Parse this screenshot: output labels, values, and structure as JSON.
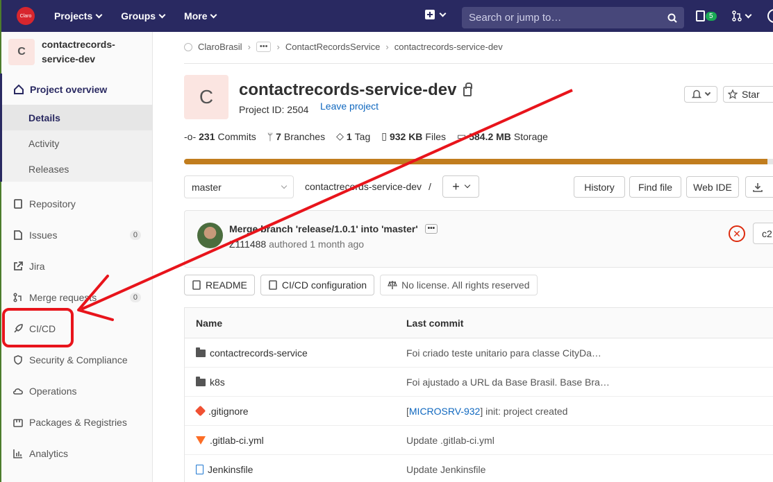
{
  "navbar": {
    "logo_text": "Claro",
    "projects_label": "Projects",
    "groups_label": "Groups",
    "more_label": "More",
    "search_placeholder": "Search or jump to…",
    "issues_count": "5"
  },
  "sidebar": {
    "project_initial": "C",
    "project_name": "contactrecords-service-dev",
    "overview_label": "Project overview",
    "subitems": [
      {
        "label": "Details"
      },
      {
        "label": "Activity"
      },
      {
        "label": "Releases"
      }
    ],
    "items": [
      {
        "label": "Repository"
      },
      {
        "label": "Issues",
        "count": "0"
      },
      {
        "label": "Jira"
      },
      {
        "label": "Merge requests",
        "count": "0"
      },
      {
        "label": "CI/CD"
      },
      {
        "label": "Security & Compliance"
      },
      {
        "label": "Operations"
      },
      {
        "label": "Packages & Registries"
      },
      {
        "label": "Analytics"
      }
    ]
  },
  "breadcrumb": {
    "root": "ClaroBrasil",
    "ellipsis": "•••",
    "group": "ContactRecordsService",
    "project": "contactrecords-service-dev"
  },
  "project": {
    "initial": "C",
    "name": "contactrecords-service-dev",
    "id_text": "Project ID: 2504",
    "leave_label": "Leave project",
    "star_label": "Star"
  },
  "stats": {
    "commits": "231",
    "commits_label": "Commits",
    "branches": "7",
    "branches_label": "Branches",
    "tags": "1",
    "tags_label": "Tag",
    "files": "932 KB",
    "files_label": "Files",
    "storage": "584.2 MB",
    "storage_label": "Storage",
    "files_fraction": 0.99
  },
  "repo": {
    "branch": "master",
    "path": "contactrecords-service-dev",
    "path_sep": "/",
    "history_label": "History",
    "find_file_label": "Find file",
    "web_ide_label": "Web IDE"
  },
  "commit": {
    "message": "Merge branch 'release/1.0.1' into 'master'",
    "dots": "•••",
    "author": "Z111488",
    "time": "authored 1 month ago",
    "sha_prefix": "c2"
  },
  "pills": {
    "readme": "README",
    "cicd": "CI/CD configuration",
    "license": "No license. All rights reserved"
  },
  "files": {
    "col_name": "Name",
    "col_commit": "Last commit",
    "rows": [
      {
        "name": "contactrecords-service",
        "type": "folder",
        "commit": "Foi criado teste unitario para classe CityDa…"
      },
      {
        "name": "k8s",
        "type": "folder",
        "commit": "Foi ajustado a URL da Base Brasil. Base Bra…"
      },
      {
        "name": ".gitignore",
        "type": "git",
        "commit_link": "MICROSRV-932",
        "commit": " init: project created"
      },
      {
        "name": ".gitlab-ci.yml",
        "type": "gitlab",
        "commit": "Update .gitlab-ci.yml"
      },
      {
        "name": "Jenkinsfile",
        "type": "doc",
        "commit": "Update Jenkinsfile"
      }
    ]
  },
  "colors": {
    "navbar": "#292961",
    "accent_blue": "#1068bf",
    "annotation_red": "#e8141b",
    "storage_bar": "#c17d1e"
  }
}
